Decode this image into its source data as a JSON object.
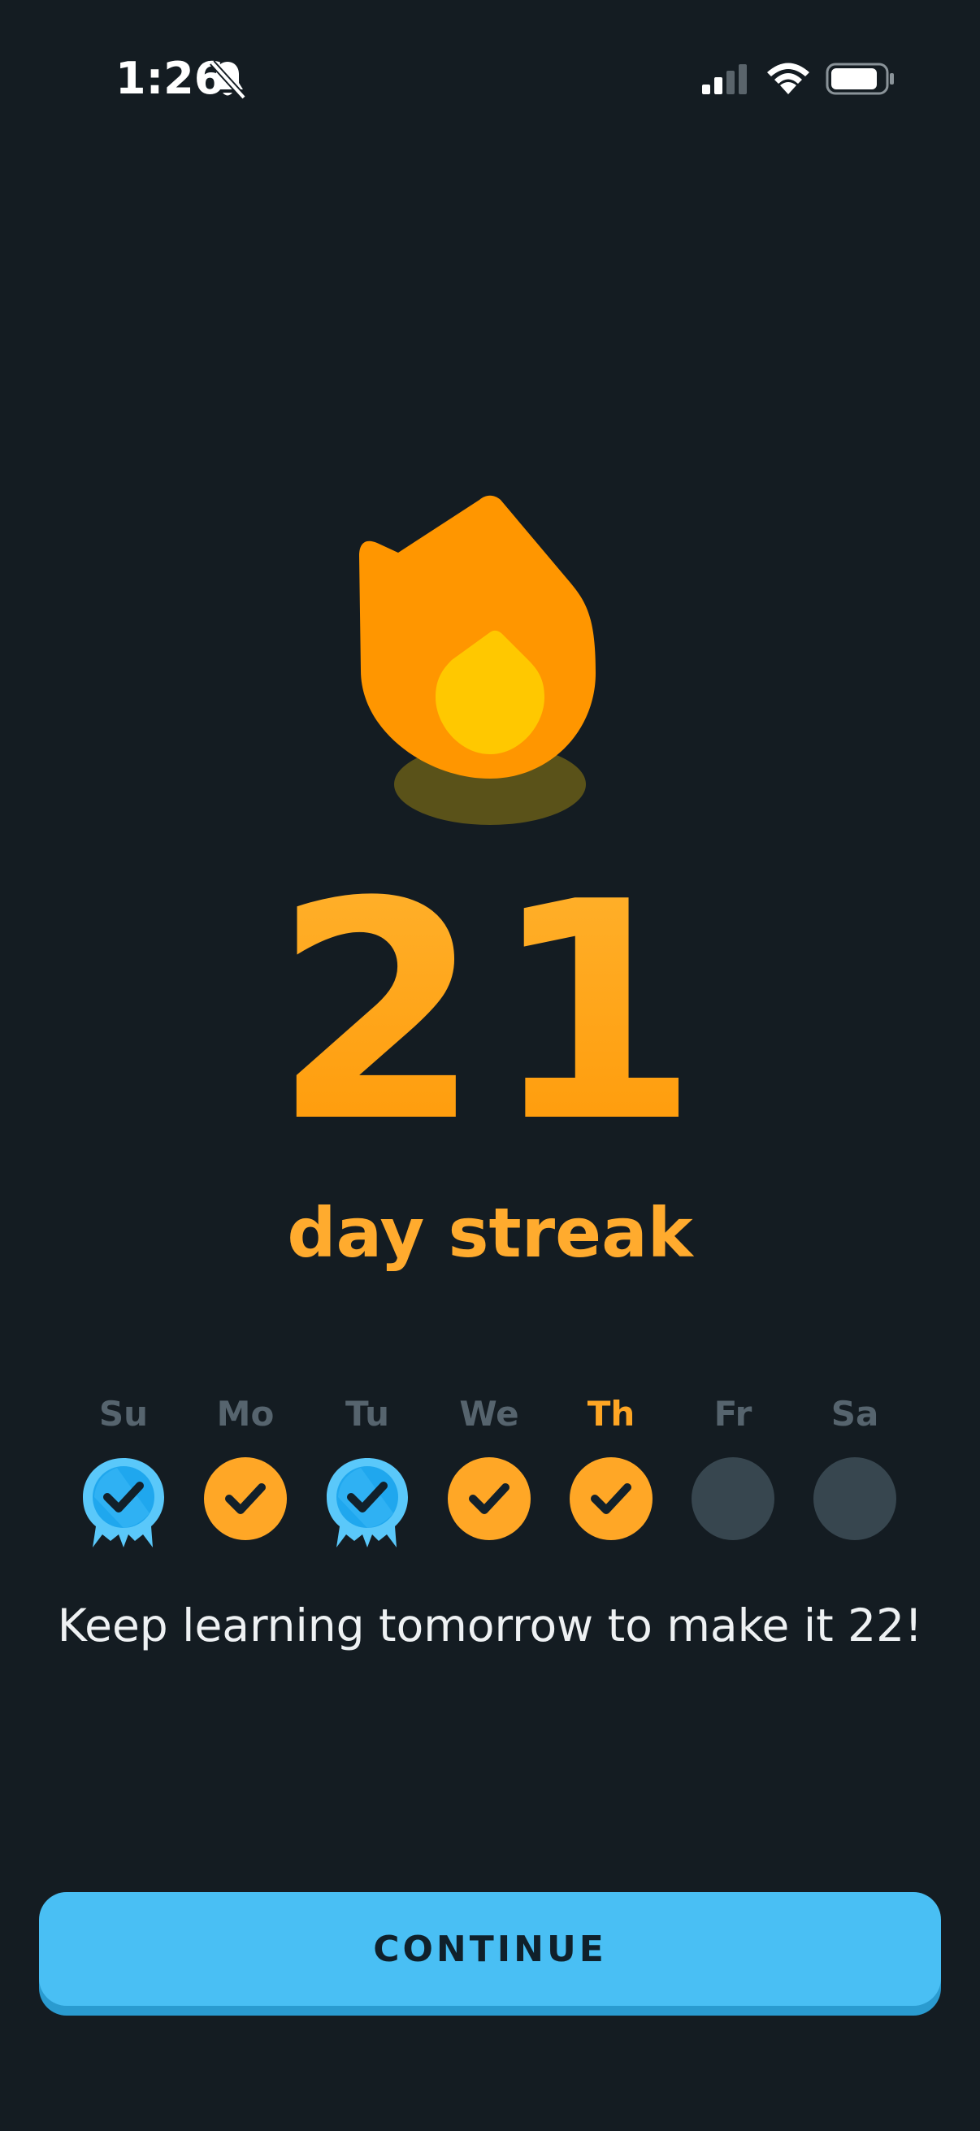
{
  "status_bar": {
    "time": "1:26",
    "icons": [
      "bell-slash-icon",
      "cellular-signal-icon",
      "wifi-icon",
      "battery-icon"
    ]
  },
  "streak": {
    "count": "21",
    "label": "day streak",
    "icon": "flame-icon"
  },
  "week": {
    "days": [
      {
        "label": "Su",
        "status": "freeze",
        "icon": "streak-freeze-check-icon"
      },
      {
        "label": "Mo",
        "status": "done",
        "icon": "check-icon"
      },
      {
        "label": "Tu",
        "status": "freeze",
        "icon": "streak-freeze-check-icon"
      },
      {
        "label": "We",
        "status": "done",
        "icon": "check-icon"
      },
      {
        "label": "Th",
        "status": "done",
        "today": true,
        "icon": "check-icon"
      },
      {
        "label": "Fr",
        "status": "empty"
      },
      {
        "label": "Sa",
        "status": "empty"
      }
    ]
  },
  "message": "Keep learning tomorrow to make it 22!",
  "continue_button": {
    "label": "CONTINUE"
  },
  "colors": {
    "background": "#141c22",
    "streak_orange": "#ffa51e",
    "flame_outer": "#ff9600",
    "flame_inner": "#ffc800",
    "done_day": "#ffa726",
    "freeze_blue": "#5ac8fa",
    "empty_day": "#37464f",
    "button": "#49bff4",
    "button_shadow": "#2a9bd0"
  }
}
